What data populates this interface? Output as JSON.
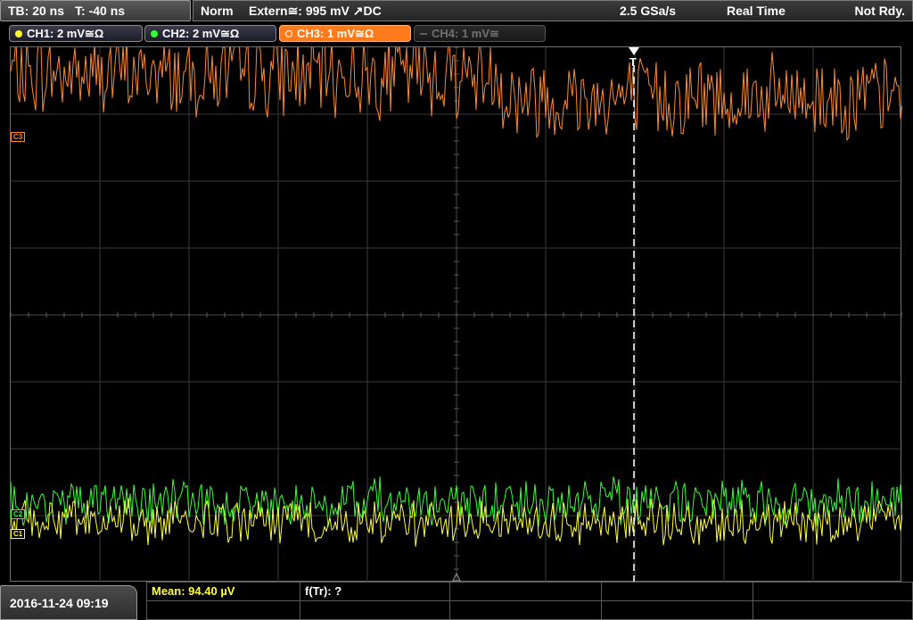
{
  "topbar": {
    "timebase": "TB: 20 ns",
    "trigger_time": "T: -40 ns",
    "acq_mode": "Norm",
    "trigger_source": "Extern≅: 995 mV ↗DC",
    "sample_rate": "2.5 GSa/s",
    "realtime": "Real Time",
    "status": "Not Rdy."
  },
  "channels": [
    {
      "label": "CH1: 2 mV≅Ω",
      "color": "#ffff33",
      "ref": "C1"
    },
    {
      "label": "CH2: 2 mV≅Ω",
      "color": "#33ff33",
      "ref": "C2"
    },
    {
      "label": "CH3: 1 mV≅Ω",
      "color": "#ff8a2a",
      "ref": "C3"
    },
    {
      "label": "CH4: 1 mV≅",
      "color": "#808080"
    }
  ],
  "trigger": {
    "label": "T"
  },
  "waveforms": {
    "ch3": {
      "color": "#ff8a2a",
      "level_div": 3.6,
      "noise_div": 0.55
    },
    "ch2": {
      "color": "#33ff33",
      "level_div": -2.8,
      "noise_div": 0.3
    },
    "ch1": {
      "color": "#ffff33",
      "level_div": -3.1,
      "noise_div": 0.3
    }
  },
  "bottom": {
    "datetime": "2016-11-24 09:19",
    "measurements": [
      {
        "label": "Mean: 94.40 µV"
      },
      {
        "label": "f(Tr): ?"
      }
    ]
  }
}
